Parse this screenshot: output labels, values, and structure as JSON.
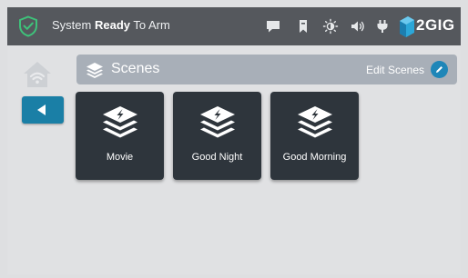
{
  "status_bar": {
    "status_prefix": "System ",
    "status_bold": "Ready",
    "status_suffix": " To Arm",
    "brand": "2GIG",
    "icons": [
      "shield-check-icon",
      "message-icon",
      "bookmark-icon",
      "brightness-icon",
      "volume-icon",
      "power-plug-icon"
    ]
  },
  "nav": {
    "icons": [
      "home-wifi-icon",
      "back-arrow-icon"
    ]
  },
  "scenes": {
    "title": "Scenes",
    "edit_label": "Edit Scenes",
    "items": [
      {
        "label": "Movie"
      },
      {
        "label": "Good Night"
      },
      {
        "label": "Good Morning"
      }
    ]
  },
  "colors": {
    "status_bar": "#55585d",
    "background": "#e0e1e3",
    "accent_blue": "#1a7fa6",
    "tile": "#2e353c",
    "header_bar": "#a8afb8",
    "shield_green": "#3ec27a"
  }
}
